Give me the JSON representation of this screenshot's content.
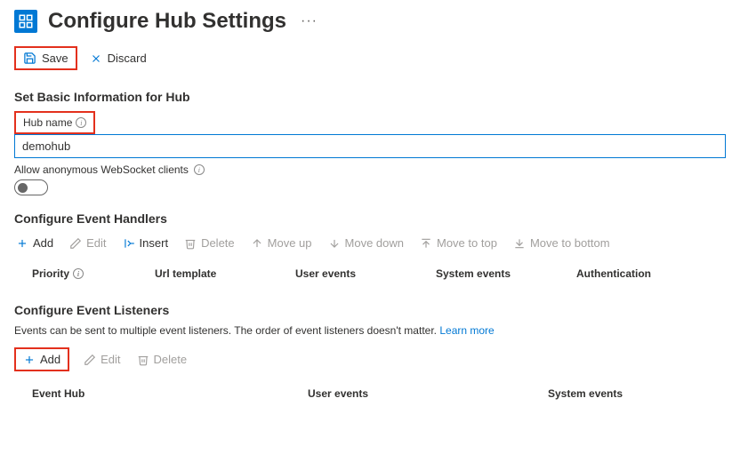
{
  "header": {
    "title": "Configure Hub Settings"
  },
  "actions": {
    "save": "Save",
    "discard": "Discard"
  },
  "basic": {
    "heading": "Set Basic Information for Hub",
    "hub_name_label": "Hub name",
    "hub_name_value": "demohub",
    "anon_label": "Allow anonymous WebSocket clients"
  },
  "handlers": {
    "heading": "Configure Event Handlers",
    "toolbar": {
      "add": "Add",
      "edit": "Edit",
      "insert": "Insert",
      "delete": "Delete",
      "move_up": "Move up",
      "move_down": "Move down",
      "move_top": "Move to top",
      "move_bottom": "Move to bottom"
    },
    "columns": {
      "priority": "Priority",
      "url": "Url template",
      "user": "User events",
      "system": "System events",
      "auth": "Authentication"
    }
  },
  "listeners": {
    "heading": "Configure Event Listeners",
    "description": "Events can be sent to multiple event listeners. The order of event listeners doesn't matter.",
    "learn_more": "Learn more",
    "toolbar": {
      "add": "Add",
      "edit": "Edit",
      "delete": "Delete"
    },
    "columns": {
      "hub": "Event Hub",
      "user": "User events",
      "system": "System events"
    }
  }
}
